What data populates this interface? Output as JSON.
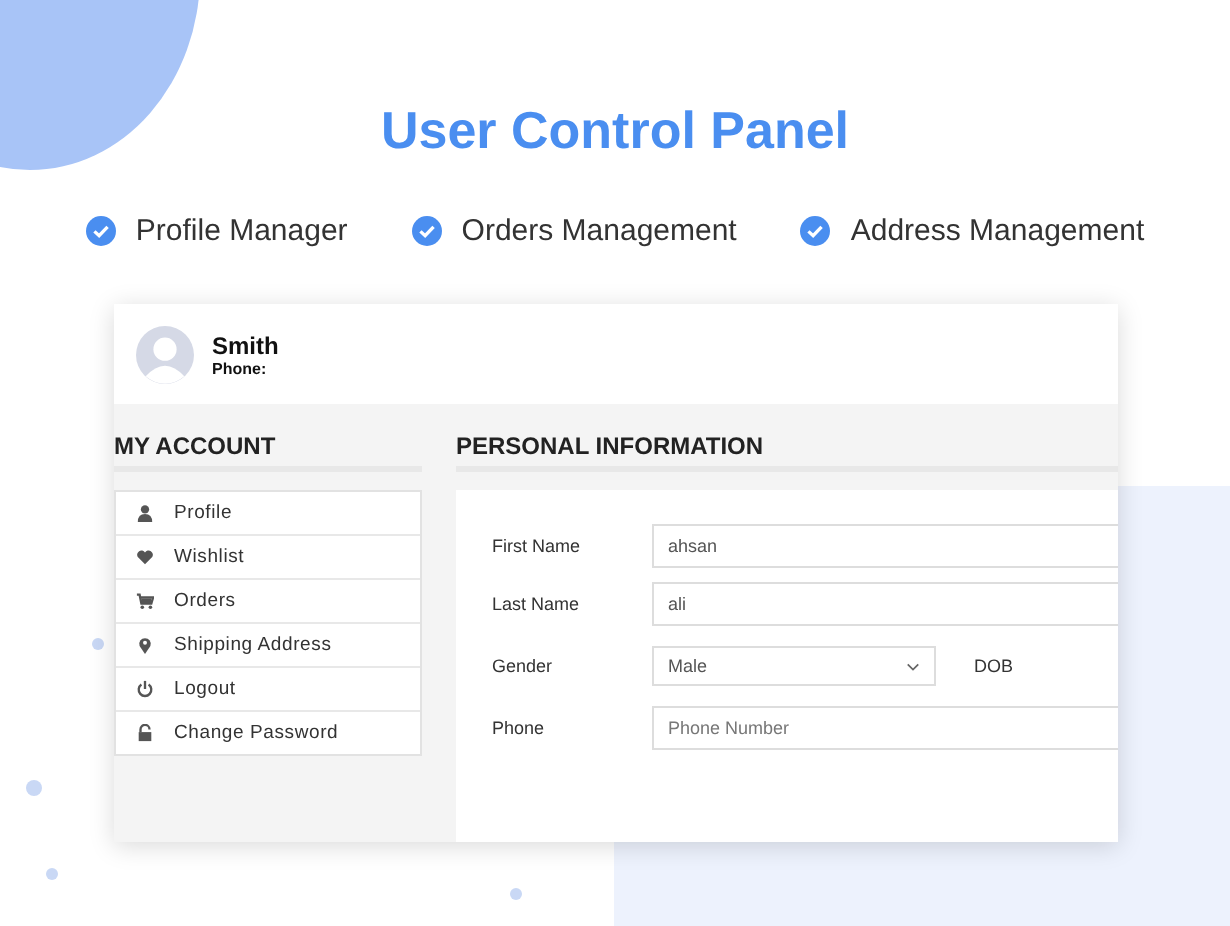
{
  "title": "User Control Panel",
  "features": [
    "Profile Manager",
    "Orders Management",
    "Address Management"
  ],
  "user": {
    "name": "Smith",
    "phone_label": "Phone:"
  },
  "account": {
    "heading": "MY ACCOUNT",
    "items": [
      "Profile",
      "Wishlist",
      "Orders",
      "Shipping Address",
      "Logout",
      "Change Password"
    ]
  },
  "personal": {
    "heading": "PERSONAL INFORMATION",
    "fields": [
      {
        "kind": "text",
        "label": "First Name",
        "value": "ahsan"
      },
      {
        "kind": "text",
        "label": "Last Name",
        "value": "ali"
      },
      {
        "kind": "select",
        "label": "Gender",
        "value": "Male",
        "side_label": "DOB"
      },
      {
        "kind": "text",
        "label": "Phone",
        "placeholder": "Phone Number"
      }
    ]
  }
}
